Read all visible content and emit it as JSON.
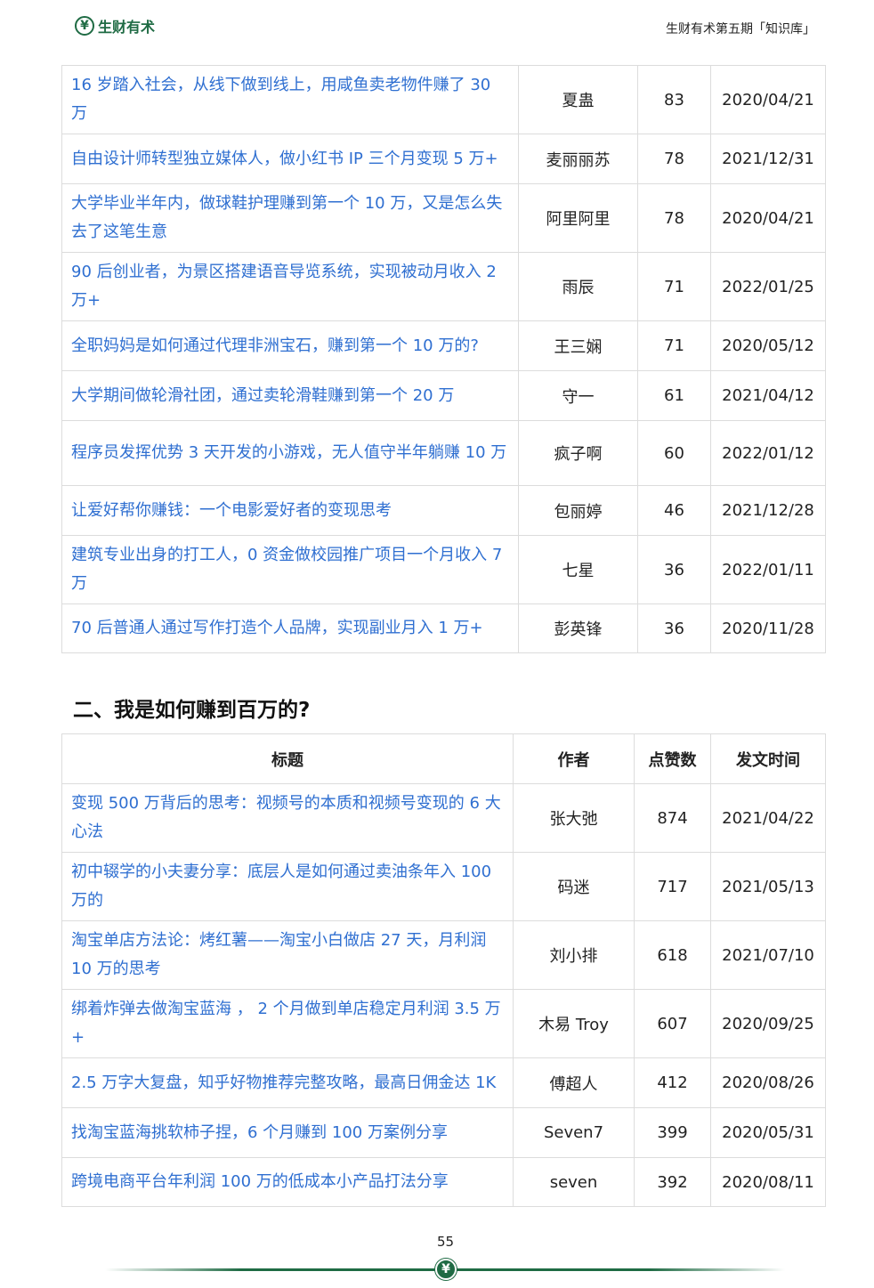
{
  "header": {
    "logo_mark": "¥",
    "logo_text": "生财有术",
    "right_text": "生财有术第五期「知识库」"
  },
  "table1": {
    "rows": [
      {
        "title": "16 岁踏入社会，从线下做到线上，用咸鱼卖老物件赚了 30 万",
        "author": "夏蛊",
        "likes": "83",
        "date": "2020/04/21"
      },
      {
        "title": "自由设计师转型独立媒体人，做小红书 IP 三个月变现 5 万+",
        "author": "麦丽丽苏",
        "likes": "78",
        "date": "2021/12/31"
      },
      {
        "title": "大学毕业半年内，做球鞋护理赚到第一个 10 万，又是怎么失去了这笔生意",
        "author": "阿里阿里",
        "likes": "78",
        "date": "2020/04/21"
      },
      {
        "title": "90 后创业者，为景区搭建语音导览系统，实现被动月收入 2 万+",
        "author": "雨辰",
        "likes": "71",
        "date": "2022/01/25"
      },
      {
        "title": "全职妈妈是如何通过代理非洲宝石，赚到第一个 10 万的?",
        "author": "王三娴",
        "likes": "71",
        "date": "2020/05/12"
      },
      {
        "title": "大学期间做轮滑社团，通过卖轮滑鞋赚到第一个 20 万",
        "author": "守一",
        "likes": "61",
        "date": "2021/04/12"
      },
      {
        "title": "程序员发挥优势 3 天开发的小游戏，无人值守半年躺赚 10 万",
        "author": "疯子啊",
        "likes": "60",
        "date": "2022/01/12"
      },
      {
        "title": "让爱好帮你赚钱：一个电影爱好者的变现思考",
        "author": "包丽婷",
        "likes": "46",
        "date": "2021/12/28"
      },
      {
        "title": "建筑专业出身的打工人，0 资金做校园推广项目一个月收入 7 万",
        "author": "七星",
        "likes": "36",
        "date": "2022/01/11"
      },
      {
        "title": "70 后普通人通过写作打造个人品牌，实现副业月入 1 万+",
        "author": "彭英锋",
        "likes": "36",
        "date": "2020/11/28"
      }
    ]
  },
  "section2": {
    "heading": "二、我是如何赚到百万的?"
  },
  "table2": {
    "headers": {
      "title": "标题",
      "author": "作者",
      "likes": "点赞数",
      "date": "发文时间"
    },
    "rows": [
      {
        "title": "变现 500 万背后的思考：视频号的本质和视频号变现的 6 大心法",
        "author": "张大弛",
        "likes": "874",
        "date": "2021/04/22"
      },
      {
        "title": "初中辍学的小夫妻分享：底层人是如何通过卖油条年入 100 万的",
        "author": "码迷",
        "likes": "717",
        "date": "2021/05/13"
      },
      {
        "title": "淘宝单店方法论：烤红薯——淘宝小白做店 27 天，月利润 10 万的思考",
        "author": "刘小排",
        "likes": "618",
        "date": "2021/07/10"
      },
      {
        "title": "绑着炸弹去做淘宝蓝海 ， 2 个月做到单店稳定月利润 3.5 万 +",
        "author": "木易 Troy",
        "likes": "607",
        "date": "2020/09/25"
      },
      {
        "title": "2.5 万字大复盘，知乎好物推荐完整攻略，最高日佣金达 1K",
        "author": "傅超人",
        "likes": "412",
        "date": "2020/08/26"
      },
      {
        "title": "找淘宝蓝海挑软柿子捏，6 个月赚到 100 万案例分享",
        "author": "Seven7",
        "likes": "399",
        "date": "2020/05/31"
      },
      {
        "title": "跨境电商平台年利润 100 万的低成本小产品打法分享",
        "author": "seven",
        "likes": "392",
        "date": "2020/08/11"
      }
    ]
  },
  "footer": {
    "page_number": "55",
    "mark": "¥"
  },
  "colors": {
    "brand": "#1f6b44",
    "link": "#2f6fd1"
  }
}
